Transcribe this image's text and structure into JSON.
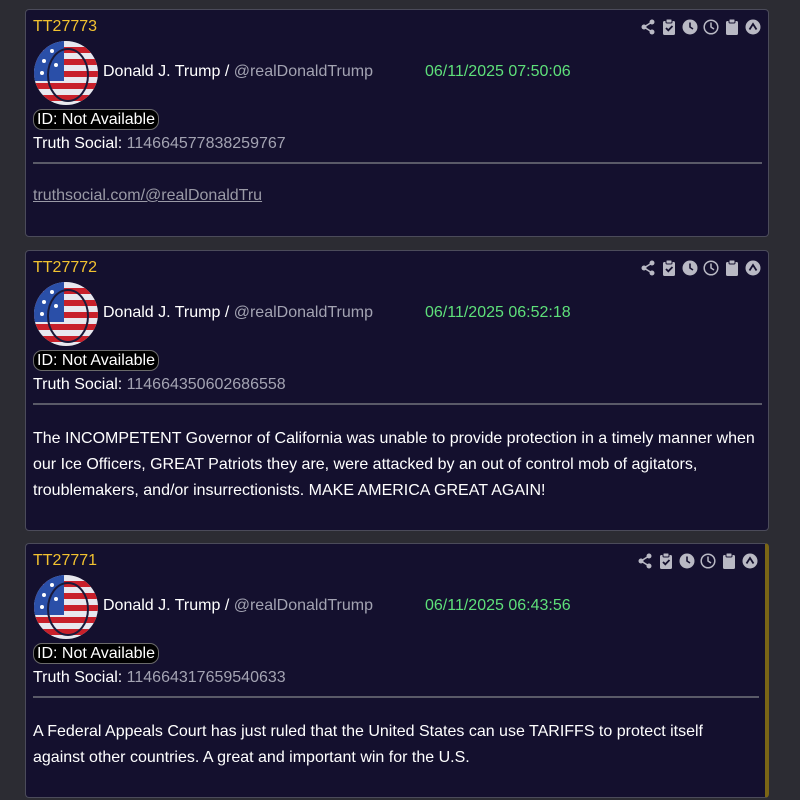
{
  "posts": [
    {
      "tt_id": "TT27773",
      "author": "Donald J. Trump /",
      "handle": "@realDonaldTrump",
      "datetime": "06/11/2025 07:50:06",
      "id_label": "ID: Not Available",
      "ts_label": "Truth Social:",
      "ts_id": "114664577838259767",
      "link": "truthsocial.com/@realDonaldTru",
      "text": ""
    },
    {
      "tt_id": "TT27772",
      "author": "Donald J. Trump /",
      "handle": "@realDonaldTrump",
      "datetime": "06/11/2025 06:52:18",
      "id_label": "ID: Not Available",
      "ts_label": "Truth Social:",
      "ts_id": "114664350602686558",
      "link": "",
      "text": "The INCOMPETENT Governor of California was unable to provide protection in a timely manner when our Ice Officers, GREAT Patriots they are, were attacked by an out of control mob of agitators, troublemakers, and/or insurrectionists. MAKE AMERICA GREAT AGAIN!"
    },
    {
      "tt_id": "TT27771",
      "author": "Donald J. Trump /",
      "handle": "@realDonaldTrump",
      "datetime": "06/11/2025 06:43:56",
      "id_label": "ID: Not Available",
      "ts_label": "Truth Social:",
      "ts_id": "114664317659540633",
      "link": "",
      "text": "A Federal Appeals Court has just ruled that the United States can use TARIFFS to protect itself against other countries. A great and important win for the U.S."
    }
  ],
  "toolbar_icons": [
    "share-icon",
    "clipboard-check-icon",
    "clock-filled-icon",
    "clock-outline-icon",
    "clipboard-icon",
    "collapse-up-icon"
  ],
  "colors": {
    "background": "#2c2c33",
    "card": "#14102e",
    "tt_id": "#f2c230",
    "date": "#5ee07a",
    "muted": "#a3a3b2"
  }
}
